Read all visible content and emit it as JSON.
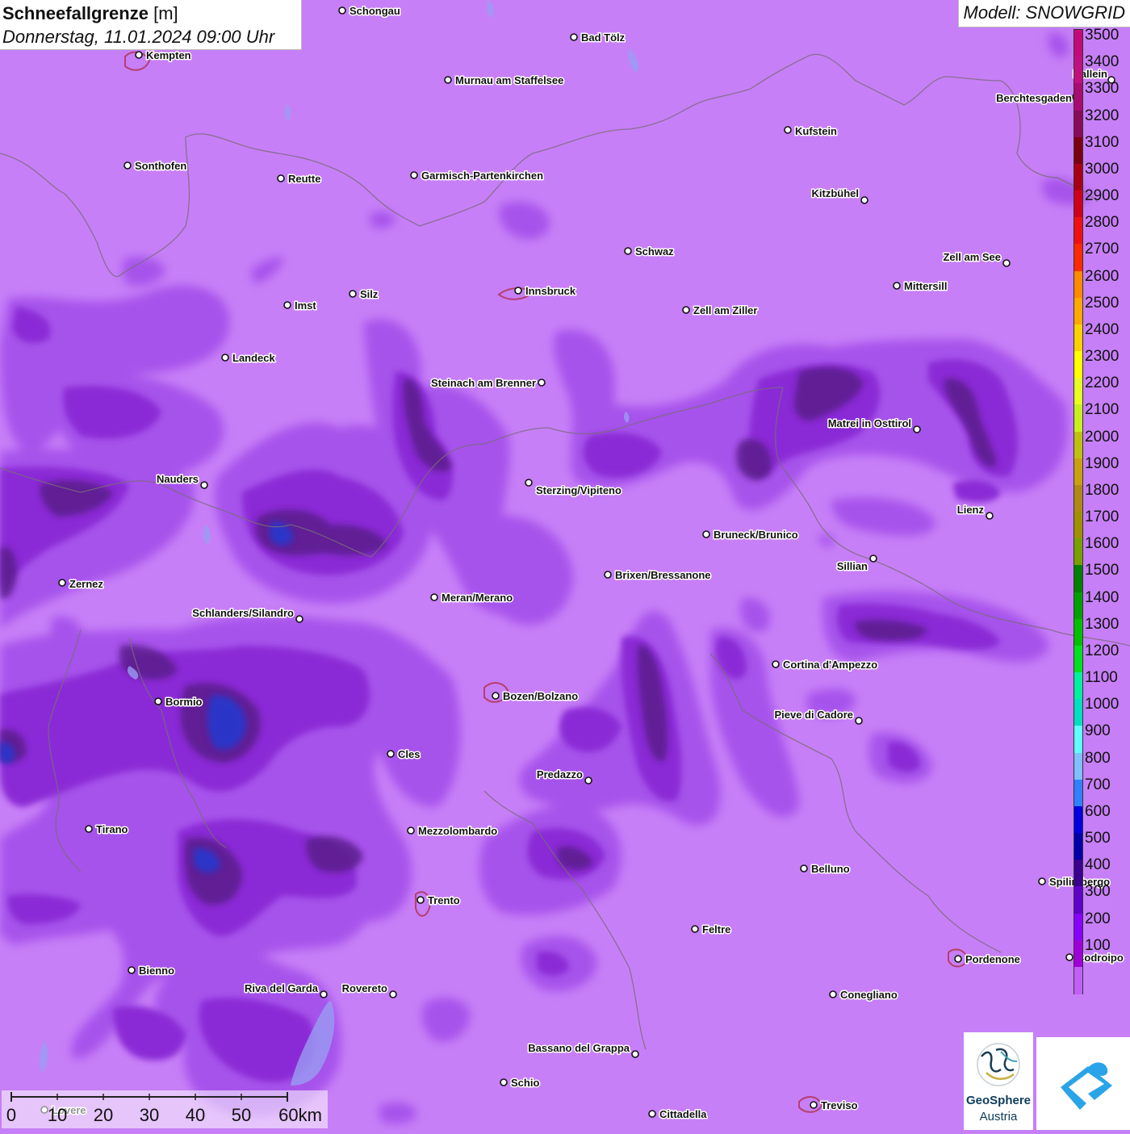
{
  "title": {
    "label": "Schneefallgrenze",
    "unit": "[m]",
    "datetime": "Donnerstag, 11.01.2024 09:00 Uhr"
  },
  "model": "Modell: SNOWGRID",
  "legend": {
    "values": [
      "3500",
      "3400",
      "3300",
      "3200",
      "3100",
      "3000",
      "2900",
      "2800",
      "2700",
      "2600",
      "2500",
      "2400",
      "2300",
      "2200",
      "2100",
      "2000",
      "1900",
      "1800",
      "1700",
      "1600",
      "1500",
      "1400",
      "1300",
      "1200",
      "1100",
      "1000",
      "900",
      "800",
      "700",
      "600",
      "500",
      "400",
      "300",
      "200",
      "100"
    ],
    "colors": [
      "#c40a78",
      "#c0107e",
      "#a80c70",
      "#8a0a5a",
      "#7a0010",
      "#a80012",
      "#d00018",
      "#f01010",
      "#ff2a00",
      "#ff8a00",
      "#ffa800",
      "#ffd000",
      "#ffff00",
      "#e6ff20",
      "#c8f020",
      "#c0c010",
      "#c8a010",
      "#b08818",
      "#a09000",
      "#78a000",
      "#008000",
      "#00a000",
      "#00c000",
      "#00e020",
      "#00f0a0",
      "#00e0c0",
      "#60ffff",
      "#80c0ff",
      "#3080ff",
      "#0000e0",
      "#0000a8",
      "#3a0090",
      "#6000c8",
      "#8800ff",
      "#a000d8",
      "#c060f8"
    ]
  },
  "cities": [
    {
      "name": "Schongau"
    },
    {
      "name": "Bad Tölz"
    },
    {
      "name": "Kempten"
    },
    {
      "name": "Murnau am Staffelsee"
    },
    {
      "name": "Hallein"
    },
    {
      "name": "Berchtesgaden"
    },
    {
      "name": "Kufstein"
    },
    {
      "name": "Sonthofen"
    },
    {
      "name": "Reutte"
    },
    {
      "name": "Garmisch-Partenkirchen"
    },
    {
      "name": "Kitzbühel"
    },
    {
      "name": "Schwaz"
    },
    {
      "name": "Zell am See"
    },
    {
      "name": "Innsbruck"
    },
    {
      "name": "Mittersill"
    },
    {
      "name": "Imst"
    },
    {
      "name": "Silz"
    },
    {
      "name": "Zell am Ziller"
    },
    {
      "name": "Landeck"
    },
    {
      "name": "Steinach am Brenner"
    },
    {
      "name": "Matrei in Osttirol"
    },
    {
      "name": "Nauders"
    },
    {
      "name": "Sterzing/Vipiteno"
    },
    {
      "name": "Lienz"
    },
    {
      "name": "Bruneck/Brunico"
    },
    {
      "name": "Sillian"
    },
    {
      "name": "Zernez"
    },
    {
      "name": "Brixen/Bressanone"
    },
    {
      "name": "Meran/Merano"
    },
    {
      "name": "Schlanders/Silandro"
    },
    {
      "name": "Cortina d'Ampezzo"
    },
    {
      "name": "Bozen/Bolzano"
    },
    {
      "name": "Bormio"
    },
    {
      "name": "Pieve di Cadore"
    },
    {
      "name": "Cles"
    },
    {
      "name": "Predazzo"
    },
    {
      "name": "Tirano"
    },
    {
      "name": "Mezzolombardo"
    },
    {
      "name": "Belluno"
    },
    {
      "name": "Spilimbergo"
    },
    {
      "name": "Trento"
    },
    {
      "name": "Feltre"
    },
    {
      "name": "Pordenone"
    },
    {
      "name": "Codroipo"
    },
    {
      "name": "Bienno"
    },
    {
      "name": "Riva del Garda"
    },
    {
      "name": "Rovereto"
    },
    {
      "name": "Conegliano"
    },
    {
      "name": "Bassano del Grappa"
    },
    {
      "name": "Schio"
    },
    {
      "name": "Treviso"
    },
    {
      "name": "Cittadella"
    },
    {
      "name": "Lovere"
    }
  ],
  "scale": {
    "labels": [
      "0",
      "10",
      "20",
      "30",
      "40",
      "50",
      "60km"
    ]
  },
  "logos": {
    "geosphere_line1": "GeoSphere",
    "geosphere_line2": "Austria"
  },
  "colors": {
    "background": "#c77ff7",
    "light_band": "#a652eb",
    "mid_band": "#8a2cd6",
    "dark_band": "#5a1a8a",
    "blue_core": "#2a35c8",
    "border": "#7a6a7a",
    "lake": "#9a9cf2"
  }
}
